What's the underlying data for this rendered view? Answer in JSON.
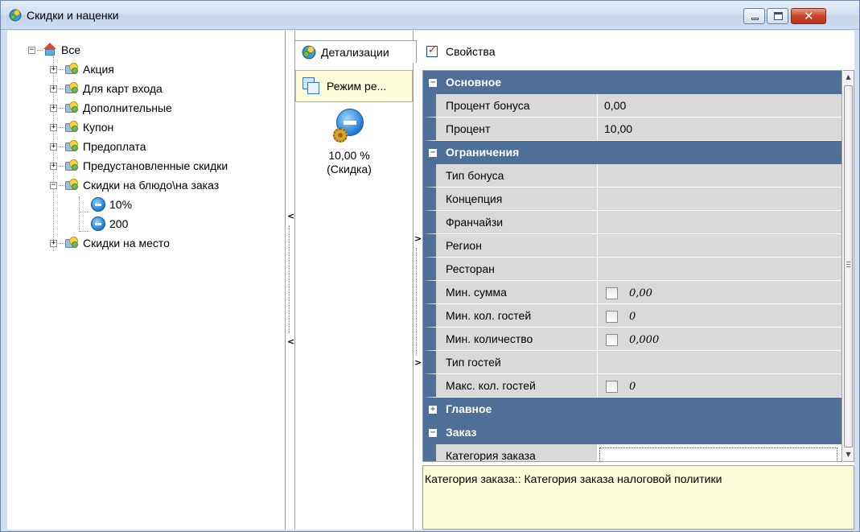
{
  "window": {
    "title": "Скидки и наценки"
  },
  "tree": {
    "root": "Все",
    "items": [
      {
        "label": "Акция",
        "expanded": false
      },
      {
        "label": "Для карт входа",
        "expanded": false
      },
      {
        "label": "Дополнительные",
        "expanded": false
      },
      {
        "label": "Купон",
        "expanded": false
      },
      {
        "label": "Предоплата",
        "expanded": false
      },
      {
        "label": "Предустановленные скидки",
        "expanded": false
      },
      {
        "label": "Скидки на блюдо\\на заказ",
        "expanded": true
      },
      {
        "label": "Скидки на место",
        "expanded": false
      }
    ],
    "children": [
      "10%",
      "200"
    ]
  },
  "tabs": {
    "detail": "Детализации",
    "properties": "Свойства"
  },
  "mid": {
    "mode_button": "Режим ре...",
    "item_value": "10,00 %",
    "item_type": "(Скидка)"
  },
  "grid": {
    "categories": {
      "main": "Основное",
      "limits": "Ограничения",
      "general": "Главное",
      "order": "Заказ"
    },
    "rows": {
      "bonus_percent": {
        "label": "Процент бонуса",
        "value": "0,00"
      },
      "percent": {
        "label": "Процент",
        "value": "10,00"
      },
      "bonus_type": {
        "label": "Тип бонуса"
      },
      "concept": {
        "label": "Концепция"
      },
      "franchise": {
        "label": "Франчайзи"
      },
      "region": {
        "label": "Регион"
      },
      "restaurant": {
        "label": "Ресторан"
      },
      "min_sum": {
        "label": "Мин. сумма",
        "value": "0,00"
      },
      "min_guests": {
        "label": "Мин. кол. гостей",
        "value": "0"
      },
      "min_qty": {
        "label": "Мин. количество",
        "value": "0,000"
      },
      "guest_type": {
        "label": "Тип гостей"
      },
      "max_guests": {
        "label": "Макс. кол. гостей",
        "value": "0"
      },
      "order_category": {
        "label": "Категория заказа"
      }
    }
  },
  "description": "Категория заказа:: Категория заказа налоговой политики",
  "colors": {
    "category_bg": "#4d6f98",
    "info_bg": "#fdfcd8",
    "row_bg": "#d9d9d9"
  }
}
